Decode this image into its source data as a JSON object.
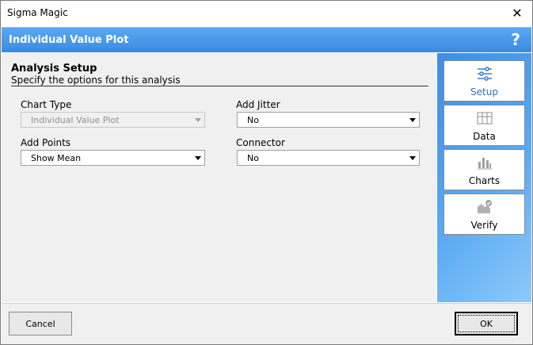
{
  "window": {
    "title": "Sigma Magic"
  },
  "header": {
    "title": "Individual Value Plot",
    "help": "?"
  },
  "section": {
    "title": "Analysis Setup",
    "subtitle": "Specify the options for this analysis"
  },
  "fields": {
    "chart_type": {
      "label": "Chart Type",
      "value": "Individual Value Plot"
    },
    "add_jitter": {
      "label": "Add Jitter",
      "value": "No"
    },
    "add_points": {
      "label": "Add Points",
      "value": "Show Mean"
    },
    "connector": {
      "label": "Connector",
      "value": "No"
    }
  },
  "tabs": [
    {
      "label": "Setup",
      "icon": "sliders-icon",
      "active": true
    },
    {
      "label": "Data",
      "icon": "grid-icon",
      "active": false
    },
    {
      "label": "Charts",
      "icon": "bar-chart-icon",
      "active": false
    },
    {
      "label": "Verify",
      "icon": "verify-icon",
      "active": false
    }
  ],
  "buttons": {
    "cancel": "Cancel",
    "ok": "OK"
  },
  "colors": {
    "accent": "#3c8ae0",
    "active_tab_text": "#2f6fbe"
  }
}
